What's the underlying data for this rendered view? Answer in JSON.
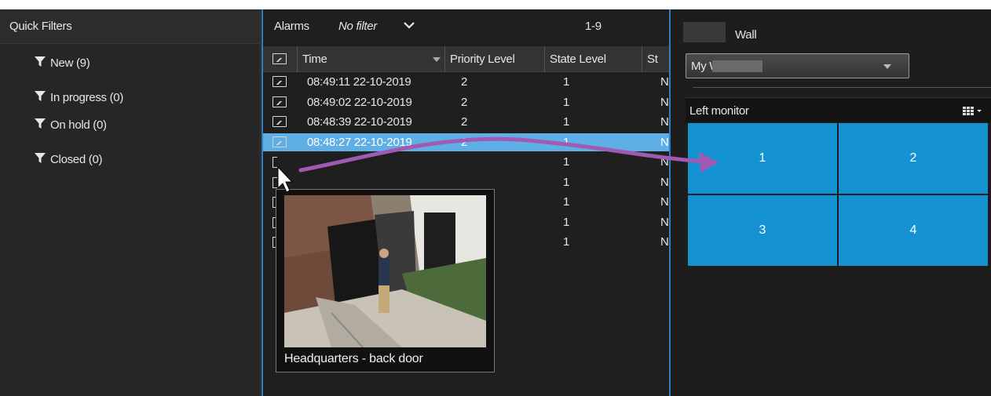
{
  "quick_filters": {
    "title": "Quick Filters",
    "items": [
      {
        "label": "New (9)"
      },
      {
        "label": "In progress (0)"
      },
      {
        "label": "On hold (0)"
      },
      {
        "label": "Closed (0)"
      }
    ]
  },
  "alarm_list": {
    "title": "Alarms",
    "filter": "No filter",
    "range": "1-9",
    "columns": [
      "Time",
      "Priority Level",
      "State Level",
      "St"
    ],
    "rows": [
      {
        "time": "08:49:11 22-10-2019",
        "priority": "2",
        "state": "1",
        "st": "N"
      },
      {
        "time": "08:49:02 22-10-2019",
        "priority": "2",
        "state": "1",
        "st": "N"
      },
      {
        "time": "08:48:39 22-10-2019",
        "priority": "2",
        "state": "1",
        "st": "N"
      },
      {
        "time": "08:48:27 22-10-2019",
        "priority": "2",
        "state": "1",
        "st": "N"
      },
      {
        "time": "",
        "priority": "",
        "state": "1",
        "st": "N"
      },
      {
        "time": "",
        "priority": "",
        "state": "1",
        "st": "N"
      },
      {
        "time": "",
        "priority": "",
        "state": "1",
        "st": "N"
      },
      {
        "time": "",
        "priority": "",
        "state": "1",
        "st": "N"
      },
      {
        "time": "",
        "priority": "",
        "state": "1",
        "st": "N"
      }
    ],
    "selected_row": 3
  },
  "preview": {
    "caption": "Headquarters - back door"
  },
  "wall": {
    "title": "Wall",
    "select_value": "My          Wall",
    "monitor_name": "Left monitor",
    "tiles": [
      "1",
      "2",
      "3",
      "4"
    ]
  },
  "colors": {
    "selection": "#5faee6",
    "tile": "#1592d1",
    "panel_border": "#2f7fc6",
    "drag_arrow": "#a05ab4"
  }
}
